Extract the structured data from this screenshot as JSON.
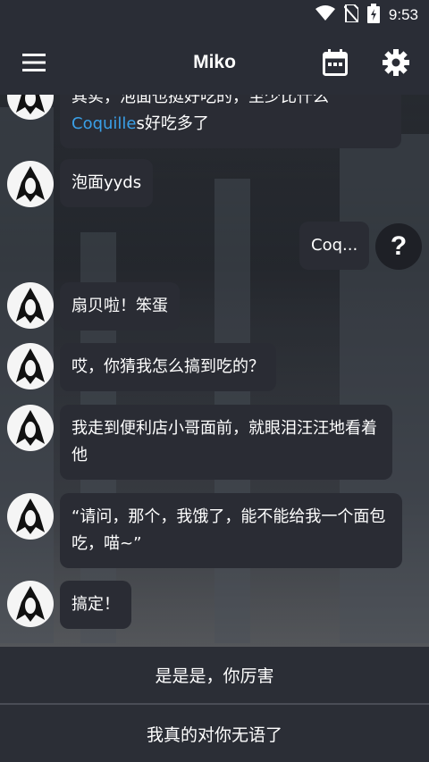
{
  "status_bar": {
    "time": "9:53"
  },
  "app_bar": {
    "title": "Miko"
  },
  "messages": [
    {
      "from": "bot",
      "text_prefix": "其实，泡面也挺好吃的，至少比什么",
      "link": "Coquille",
      "text_suffix": "s好吃多了"
    },
    {
      "from": "bot",
      "text": "泡面yyds"
    },
    {
      "from": "user",
      "text": "Coq..."
    },
    {
      "from": "bot",
      "text": "扇贝啦！笨蛋"
    },
    {
      "from": "bot",
      "text": "哎，你猜我怎么搞到吃的？"
    },
    {
      "from": "bot",
      "text": "我走到便利店小哥面前，就眼泪汪汪地看着他"
    },
    {
      "from": "bot",
      "text": "“请问，那个，我饿了，能不能给我一个面包吃，喵~”"
    },
    {
      "from": "bot",
      "text": "搞定！"
    }
  ],
  "user_avatar": "?",
  "replies": [
    "是是是，你厉害",
    "我真的对你无语了"
  ],
  "icons": [
    "wifi-icon",
    "no-sim-icon",
    "battery-charging-icon",
    "menu-icon",
    "calendar-icon",
    "settings-gear-icon"
  ],
  "colors": {
    "bar": "#2a2d36",
    "bubble": "#2a2c34",
    "link": "#3aa0e8"
  }
}
